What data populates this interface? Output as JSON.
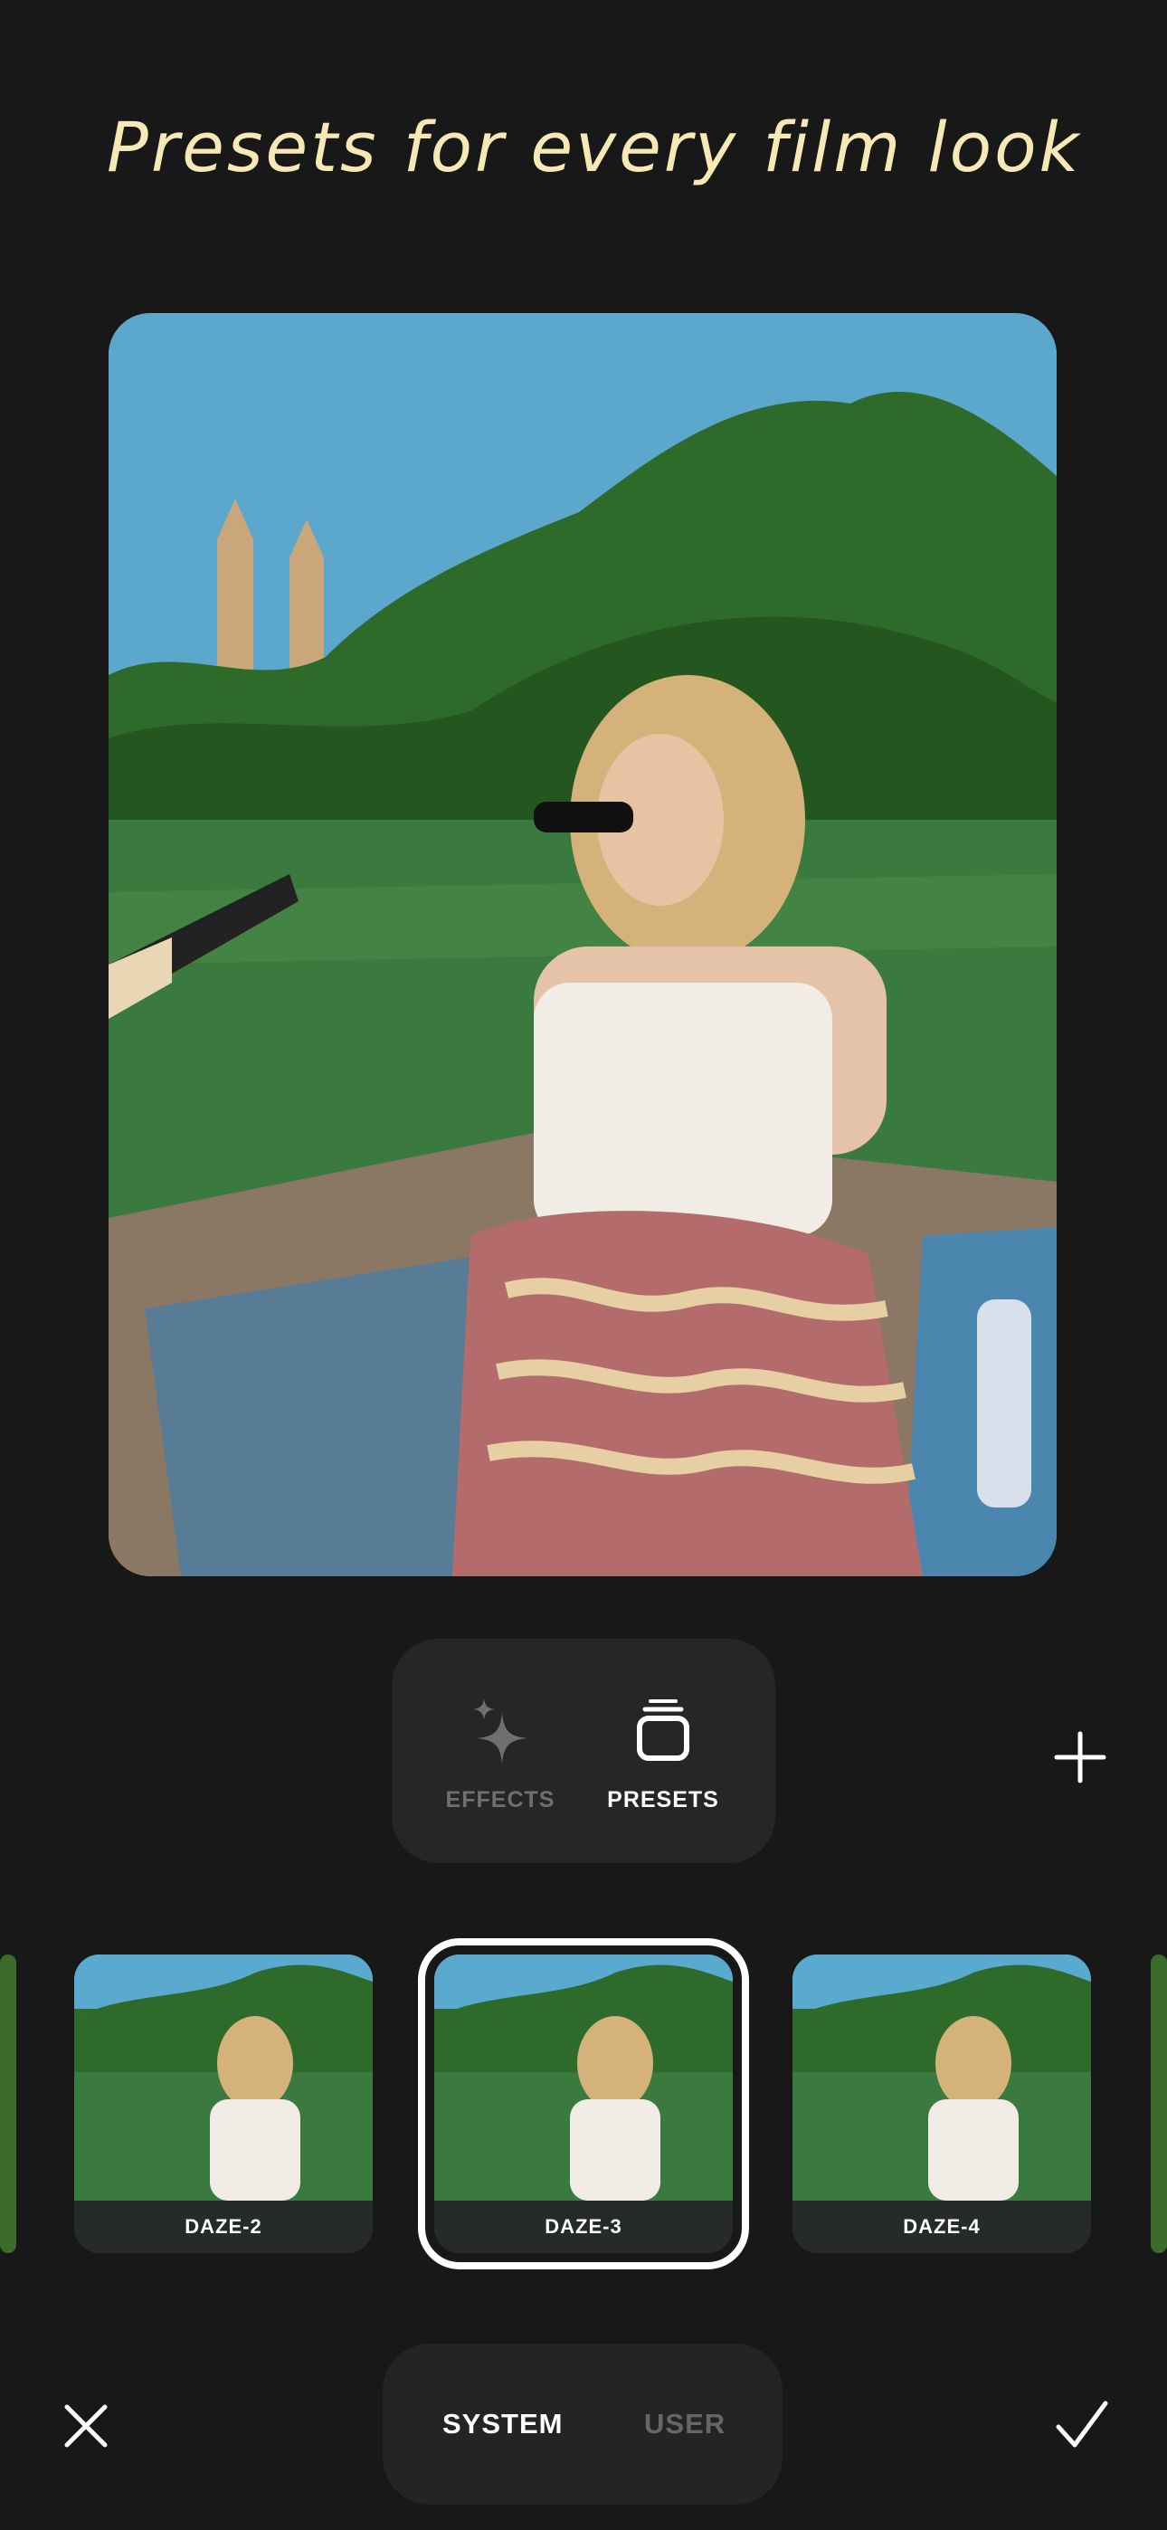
{
  "headline": "Presets for every film look",
  "mode_switch": {
    "effects_label": "EFFECTS",
    "presets_label": "PRESETS",
    "selected": "PRESETS"
  },
  "presets": [
    {
      "name": "DAZE-2",
      "selected": false
    },
    {
      "name": "DAZE-3",
      "selected": true
    },
    {
      "name": "DAZE-4",
      "selected": false
    }
  ],
  "source_switch": {
    "system_label": "SYSTEM",
    "user_label": "USER",
    "selected": "SYSTEM"
  },
  "icons": {
    "effects": "sparkles-icon",
    "presets": "stack-icon",
    "add": "plus-icon",
    "close": "close-icon",
    "confirm": "checkmark-icon"
  },
  "colors": {
    "background": "#181818",
    "headline": "#f6e9b5",
    "panel": "#252727",
    "active": "#ffffff",
    "inactive": "#6f6f6f"
  }
}
